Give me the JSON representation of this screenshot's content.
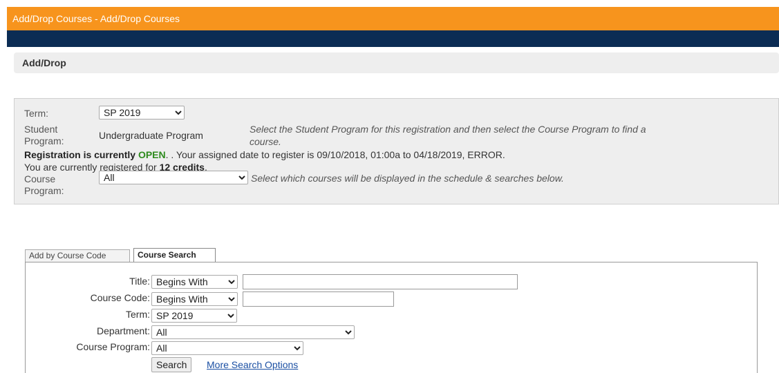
{
  "header": {
    "title": "Add/Drop Courses - Add/Drop Courses"
  },
  "panel": {
    "title": "Add/Drop"
  },
  "registration": {
    "term_label": "Term:",
    "term_value": "SP 2019",
    "student_program_label_1": "Student",
    "student_program_label_2": "Program:",
    "student_program_value": "Undergraduate Program",
    "student_program_hint_1": "Select the Student Program for this registration and then select the Course Program to find a",
    "student_program_hint_2": "course.",
    "status_prefix": "Registration is currently ",
    "status_value": "OPEN",
    "status_suffix": ". . Your assigned date to register is 09/10/2018, 01:00a to 04/18/2019, ERROR.",
    "credits_prefix": "You are currently registered for ",
    "credits_value": "12 credits",
    "credits_suffix": ".",
    "course_program_label_1": "Course",
    "course_program_label_2": "Program:",
    "course_program_value": "All",
    "course_program_hint": "Select which courses will be displayed in the schedule & searches below."
  },
  "tabs": [
    {
      "label": "Add by Course Code",
      "active": false
    },
    {
      "label": "Course Search",
      "active": true
    }
  ],
  "search": {
    "title_label": "Title:",
    "title_mode": "Begins With",
    "title_value": "",
    "code_label": "Course Code:",
    "code_mode": "Begins With",
    "code_value": "",
    "term_label": "Term:",
    "term_value": "SP 2019",
    "department_label": "Department:",
    "department_value": "All",
    "course_program_label": "Course Program:",
    "course_program_value": "All",
    "search_button": "Search",
    "more_options_link": "More Search Options"
  },
  "colors": {
    "header_orange": "#f7941d",
    "nav_navy": "#0b2c54",
    "open_green": "#2e8b1e",
    "link_blue": "#1a4fa3"
  },
  "icons": [
    "dropdown-arrow-icon"
  ]
}
